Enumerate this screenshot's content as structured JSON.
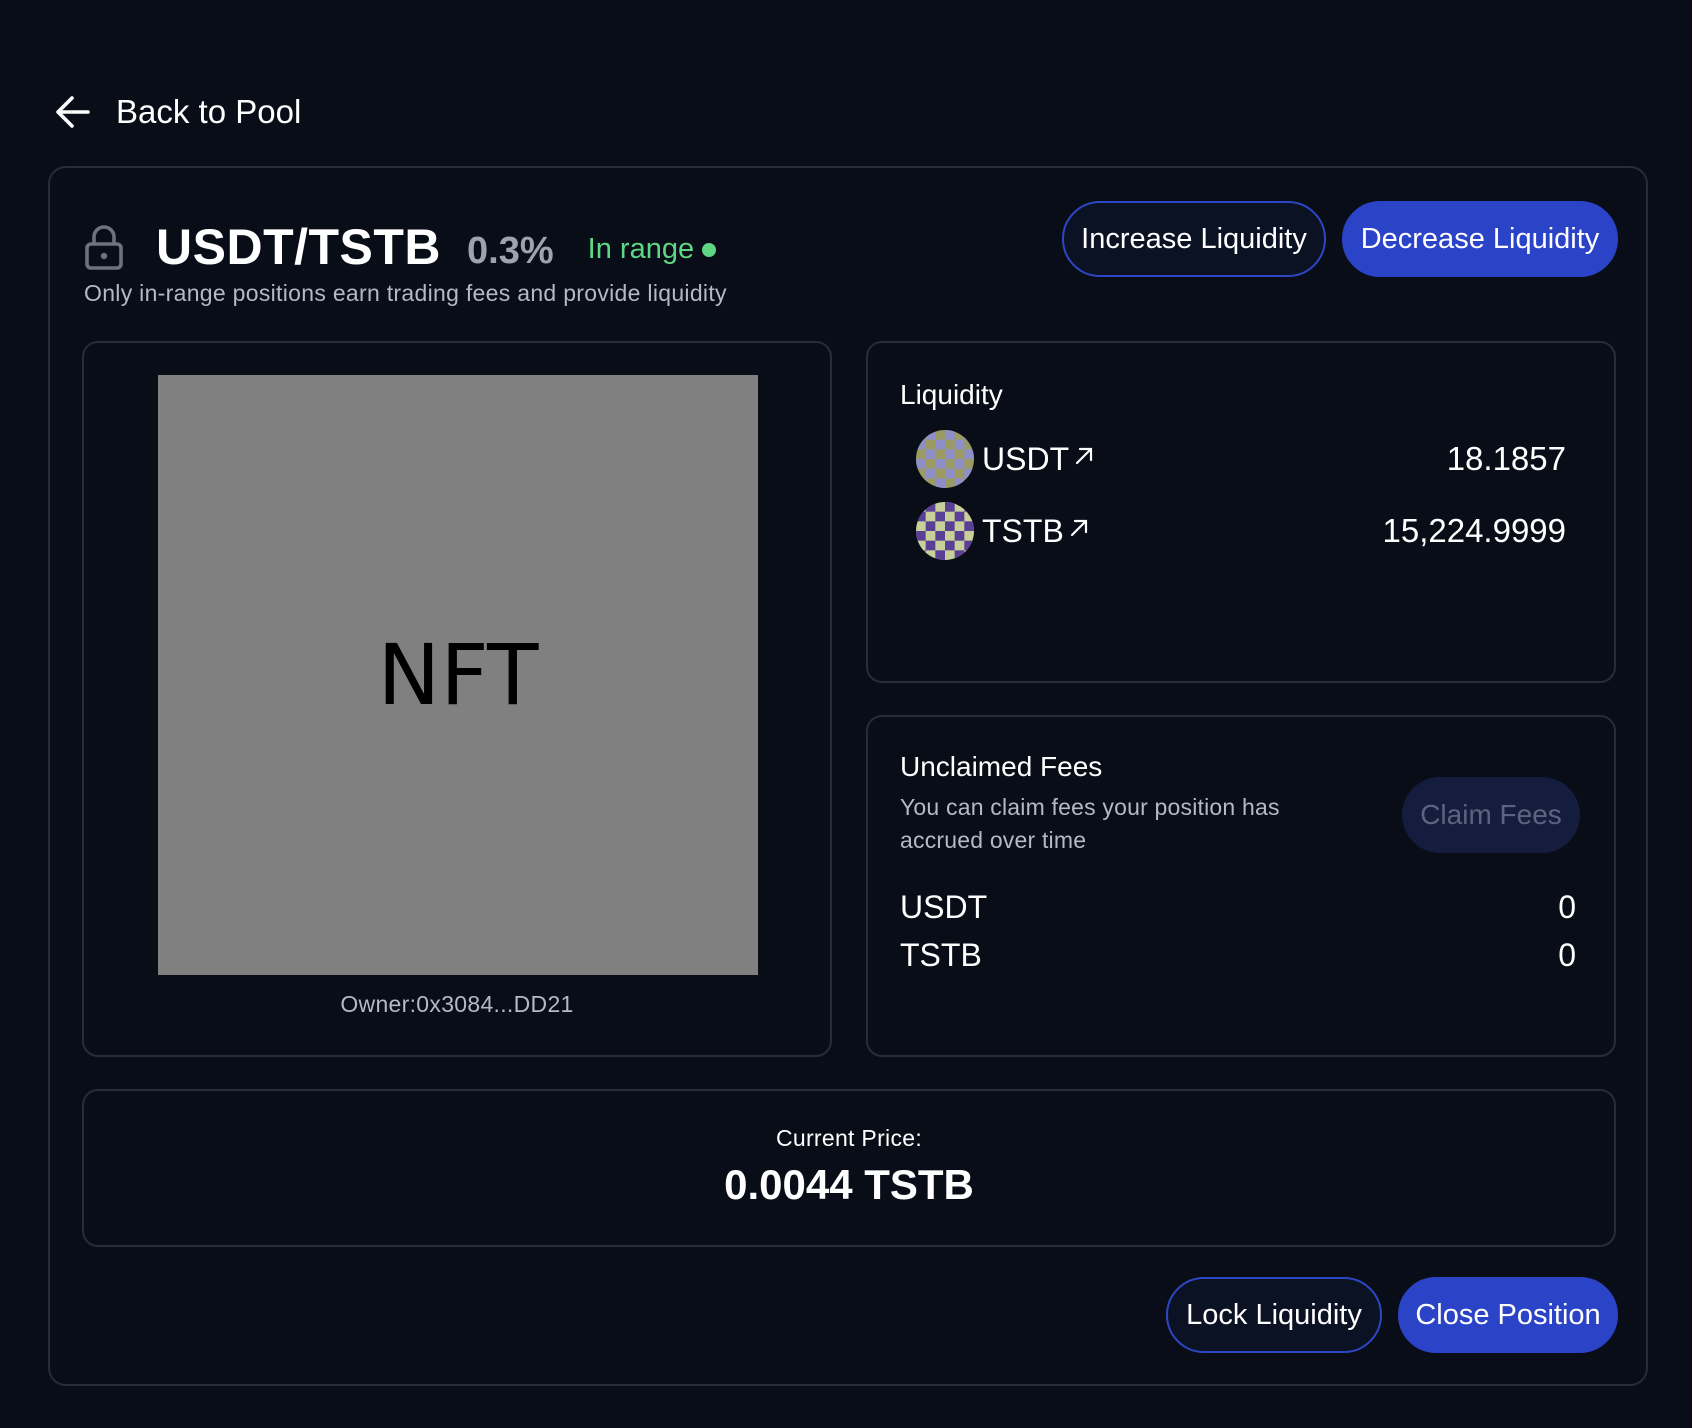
{
  "nav": {
    "back_label": "Back to Pool"
  },
  "position": {
    "pair": "USDT/TSTB",
    "fee_tier": "0.3%",
    "range_status": "In range",
    "subtitle": "Only in-range positions earn trading fees and provide liquidity"
  },
  "actions": {
    "increase_label": "Increase Liquidity",
    "decrease_label": "Decrease Liquidity",
    "lock_label": "Lock Liquidity",
    "close_label": "Close Position"
  },
  "nft": {
    "placeholder_text": "NFT",
    "owner_label": "Owner:",
    "owner_address": "0x3084...DD21"
  },
  "liquidity": {
    "title": "Liquidity",
    "tokens": [
      {
        "symbol": "USDT",
        "amount": "18.1857",
        "icon": "usdt-token-icon",
        "link_icon": "external-link-icon"
      },
      {
        "symbol": "TSTB",
        "amount": "15,224.9999",
        "icon": "tstb-token-icon",
        "link_icon": "external-link-icon"
      }
    ]
  },
  "fees": {
    "title": "Unclaimed Fees",
    "description": "You can claim fees your position has accrued over time",
    "claim_label": "Claim Fees",
    "claim_enabled": false,
    "tokens": [
      {
        "symbol": "USDT",
        "amount": "0"
      },
      {
        "symbol": "TSTB",
        "amount": "0"
      }
    ]
  },
  "price": {
    "label": "Current Price:",
    "value": "0.0044 TSTB"
  },
  "icons": {
    "back": "arrow-left-icon",
    "lock": "lock-icon",
    "range": "status-dot"
  },
  "colors": {
    "background": "#080d17",
    "border": "#272d38",
    "accent_blue": "#2b43c7",
    "in_range_green": "#5fd685",
    "muted_text": "#b4bac4",
    "nft_placeholder": "#808080",
    "disabled_button": "#151d3e"
  }
}
